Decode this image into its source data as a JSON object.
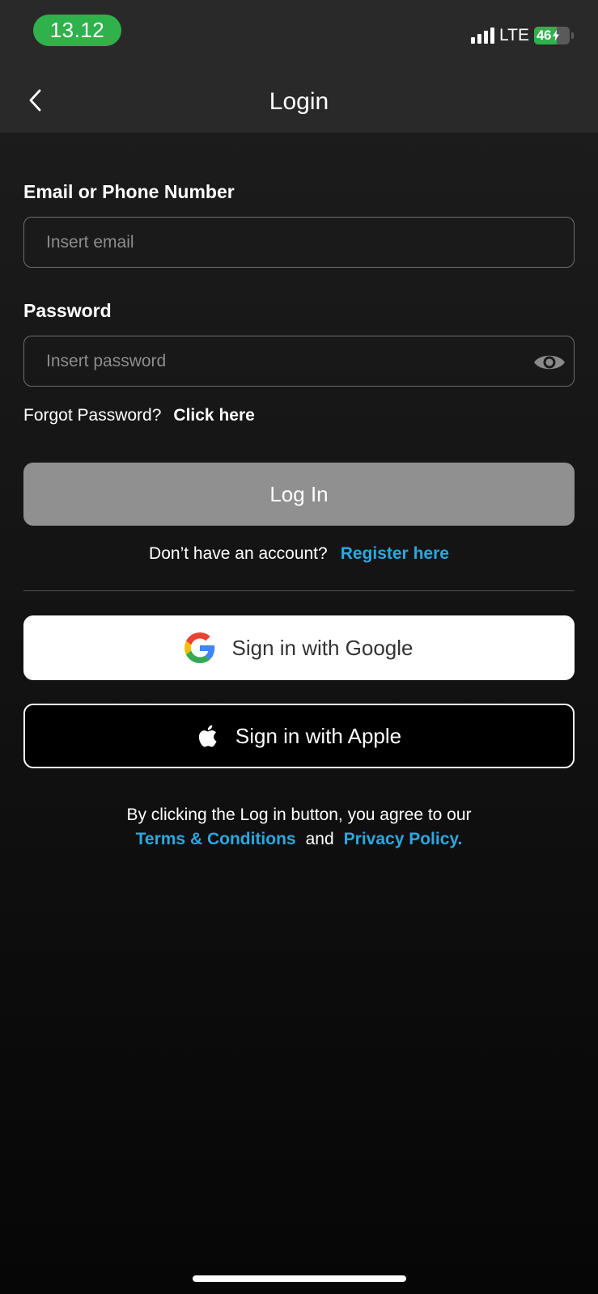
{
  "status_bar": {
    "time": "13.12",
    "network": "LTE",
    "battery_level": "46",
    "signal_bars": 4
  },
  "header": {
    "title": "Login",
    "back_icon": "chevron-left-icon"
  },
  "form": {
    "email_label": "Email or Phone Number",
    "email_placeholder": "Insert email",
    "email_value": "",
    "password_label": "Password",
    "password_placeholder": "Insert password",
    "password_value": "",
    "password_toggle_icon": "eye-icon",
    "forgot_text": "Forgot Password?",
    "forgot_link": "Click here",
    "login_button": "Log In"
  },
  "register": {
    "prompt": "Don’t have an account?",
    "link": "Register here"
  },
  "social": {
    "google_label": "Sign in with Google",
    "google_icon": "google-icon",
    "apple_label": "Sign in with Apple",
    "apple_icon": "apple-icon"
  },
  "legal": {
    "text": "By clicking the Log in button, you agree to our",
    "terms_link": "Terms & Conditions",
    "and": "and",
    "privacy_link": "Privacy Policy."
  },
  "colors": {
    "accent_link": "#2aa8e0",
    "status_green": "#2fb14c",
    "login_button_disabled": "#909090"
  }
}
